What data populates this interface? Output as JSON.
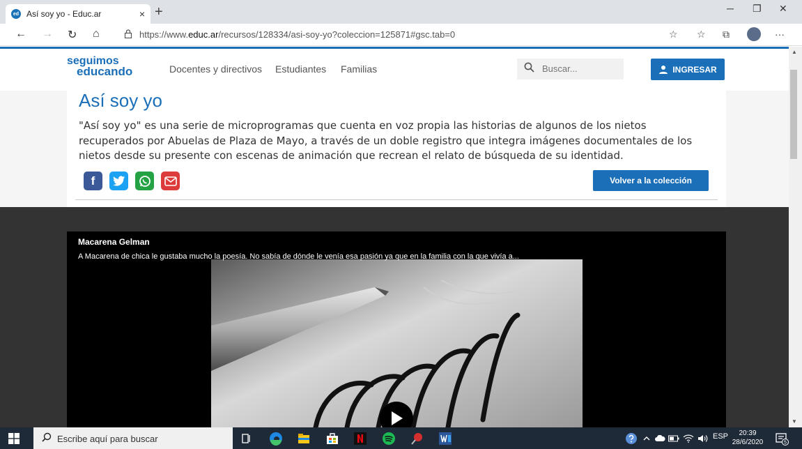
{
  "browser": {
    "tab_title": "Así soy yo - Educ.ar",
    "tab_close": "×",
    "new_tab": "+",
    "favicon_text": "ed",
    "url_prefix": "https://www.",
    "url_domain": "educ.ar",
    "url_path": "/recursos/128334/asi-soy-yo?coleccion=125871#gsc.tab=0",
    "minimize": "─",
    "restore": "❐",
    "close": "✕",
    "back": "←",
    "forward": "→",
    "refresh": "↻",
    "home": "⌂",
    "lock": "🔒",
    "favorite": "☆",
    "favorites_bar": "☆",
    "collections": "⧉",
    "more": "···"
  },
  "site": {
    "logo_line1": "seguimos",
    "logo_line2": "educando",
    "nav": [
      "Docentes y directivos",
      "Estudiantes",
      "Familias"
    ],
    "search_placeholder": "Buscar...",
    "login_label": "INGRESAR"
  },
  "resource": {
    "title": "Así soy yo",
    "description": "\"Así soy yo\" es una serie de microprogramas que cuenta en voz propia las historias de algunos de los nietos recuperados por Abuelas de Plaza de Mayo, a través de un doble registro que integra imágenes documentales de los nietos desde su presente con escenas de animación que recrean el relato de búsqueda de su identidad.",
    "share": {
      "facebook": "f",
      "twitter": "t",
      "whatsapp": "w",
      "email": "@"
    },
    "back_label": "Volver a la colección"
  },
  "video": {
    "title": "Macarena Gelman",
    "description": "A Macarena de chica le gustaba mucho la poesía. No sabía de dónde le venía esa pasión ya que en la familia con la que vivía a..."
  },
  "taskbar": {
    "search_text": "Escribe aquí para buscar",
    "language": "ESP",
    "time": "20:39",
    "date": "28/6/2020",
    "notifications": "5"
  }
}
